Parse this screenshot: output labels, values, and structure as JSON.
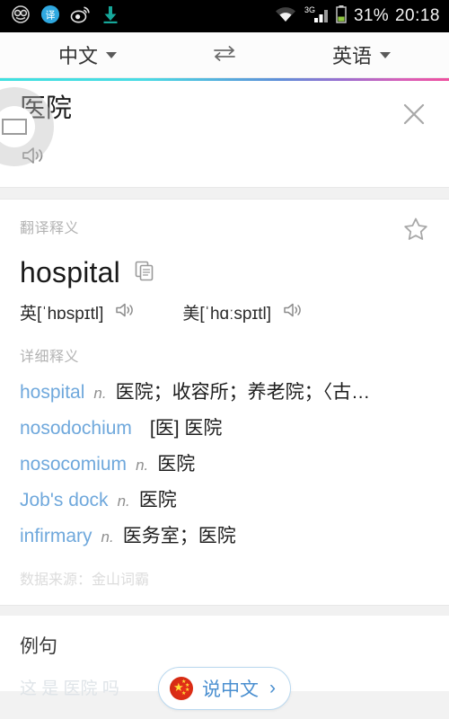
{
  "statusbar": {
    "icons": [
      "smiley-glasses-icon",
      "translate-app-icon",
      "weibo-icon",
      "download-icon"
    ],
    "wifi_icon": "wifi-icon",
    "network_label": "3G",
    "battery_icon": "battery-icon",
    "battery_percent": "31%",
    "time": "20:18"
  },
  "langbar": {
    "source_language": "中文",
    "swap_icon": "swap-arrows-icon",
    "target_language": "英语"
  },
  "search": {
    "query": "医院",
    "close_icon": "close-icon",
    "speak_icon": "speaker-icon"
  },
  "translation_card": {
    "section_label": "翻译释义",
    "favorite_icon": "star-icon",
    "headword": "hospital",
    "copy_icon": "copy-icon",
    "phonetics": [
      {
        "region": "英",
        "ipa": "[ˈhɒspɪtl]",
        "speak_icon": "speaker-icon"
      },
      {
        "region": "美",
        "ipa": "[ˈhɑːspɪtl]",
        "speak_icon": "speaker-icon"
      }
    ],
    "detail_label": "详细释义",
    "definitions": [
      {
        "word": "hospital",
        "pos": "n.",
        "meaning": "医院；收容所；养老院；〈古…"
      },
      {
        "word": "nosodochium",
        "pos": "",
        "meaning": "[医] 医院"
      },
      {
        "word": "nosocomium",
        "pos": "n.",
        "meaning": "医院"
      },
      {
        "word": "Job's dock",
        "pos": "n.",
        "meaning": "医院"
      },
      {
        "word": "infirmary",
        "pos": "n.",
        "meaning": "医务室；医院"
      }
    ],
    "source_note": "数据来源：金山词霸"
  },
  "examples": {
    "title": "例句",
    "partial_row": "这 是 医院 吗"
  },
  "speak_pill": {
    "flag_icon": "china-flag-icon",
    "label": "说中文",
    "chevron_icon": "chevron-right-icon"
  },
  "overlay": {
    "assistive_bubble_icon": "assistive-touch-icon"
  },
  "colors": {
    "accent_blue": "#6fa8dc",
    "pill_blue": "#4a8fd0",
    "status_bg": "#000000",
    "muted_gray": "#b3b3b3"
  }
}
